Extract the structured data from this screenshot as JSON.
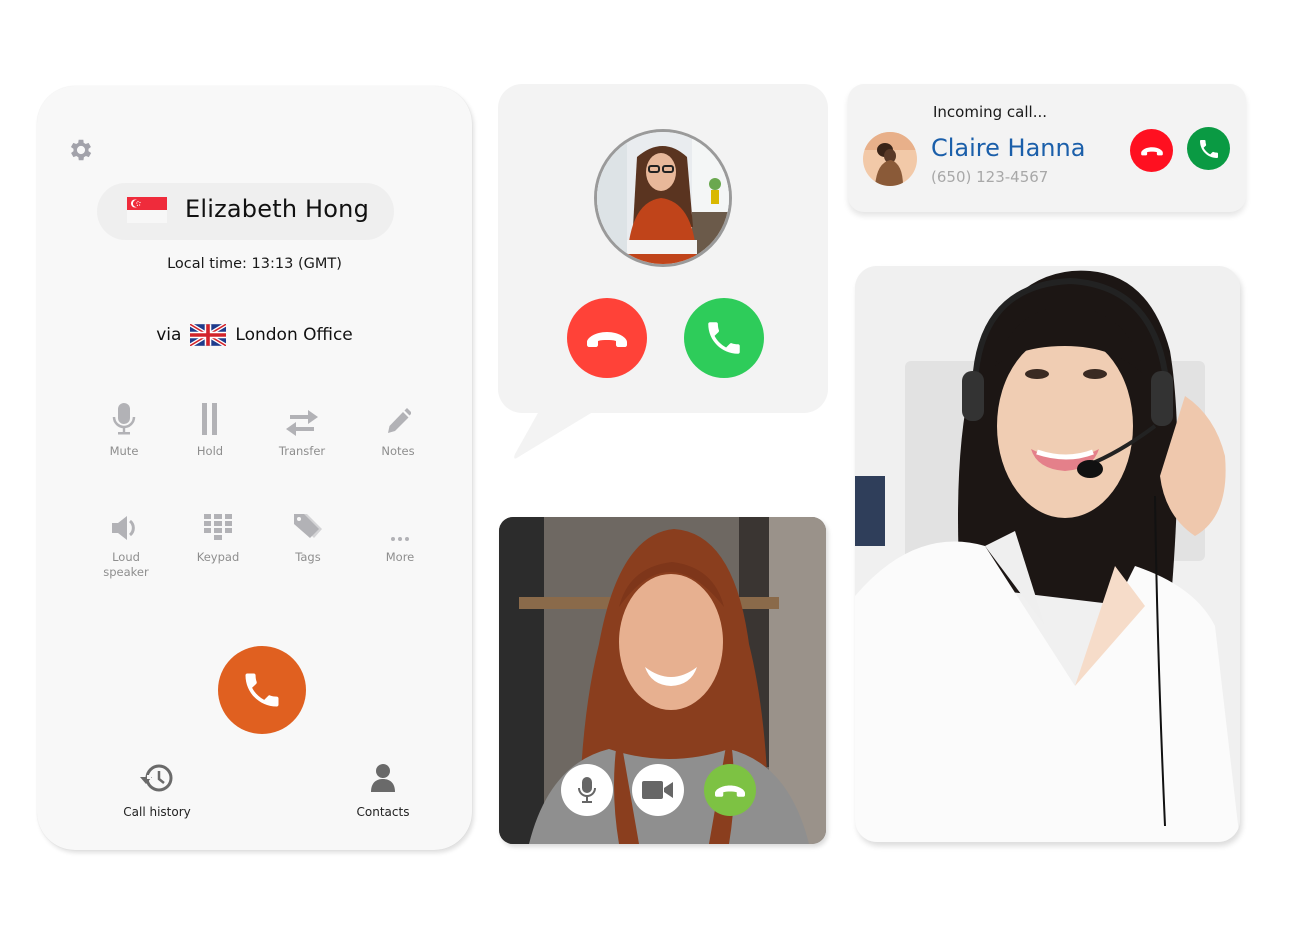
{
  "dialer": {
    "settings_icon": "gear-icon",
    "contact_name": "Elizabeth Hong",
    "contact_flag": "singapore-flag",
    "local_time": "Local time: 13:13 (GMT)",
    "via_label": "via",
    "via_flag": "united-kingdom-flag",
    "via_office": "London Office",
    "actions": [
      {
        "label": "Mute",
        "icon": "microphone-icon"
      },
      {
        "label": "Hold",
        "icon": "pause-icon"
      },
      {
        "label": "Transfer",
        "icon": "transfer-arrows-icon"
      },
      {
        "label": "Notes",
        "icon": "pencil-icon"
      },
      {
        "label": "Loud\nspeaker",
        "icon": "speaker-icon"
      },
      {
        "label": "Keypad",
        "icon": "keypad-icon"
      },
      {
        "label": "Tags",
        "icon": "tag-icon"
      },
      {
        "label": "More",
        "icon": "more-dots-icon"
      }
    ],
    "call_button_icon": "phone-icon",
    "call_button_color": "#e06020",
    "bottom_nav": [
      {
        "label": "Call history",
        "icon": "history-icon"
      },
      {
        "label": "Contacts",
        "icon": "person-icon"
      }
    ]
  },
  "bubble_call": {
    "avatar": "caller-photo-woman-glasses",
    "decline_color": "#ff4238",
    "accept_color": "#2ecc5a"
  },
  "video_call": {
    "photo": "video-participant-woman-smiling",
    "controls": [
      {
        "name": "mic",
        "icon": "microphone-icon"
      },
      {
        "name": "camera",
        "icon": "video-camera-icon"
      },
      {
        "name": "end",
        "icon": "hang-up-icon",
        "color": "#7dc243"
      }
    ]
  },
  "incoming_toast": {
    "status": "Incoming call...",
    "caller_name": "Claire Hanna",
    "caller_number": "(650) 123-4567",
    "caller_color": "#1b5faa",
    "decline_color": "#ff1020",
    "accept_color": "#0a9a43"
  },
  "agent_photo": {
    "description": "customer-support-agent-with-headset"
  }
}
